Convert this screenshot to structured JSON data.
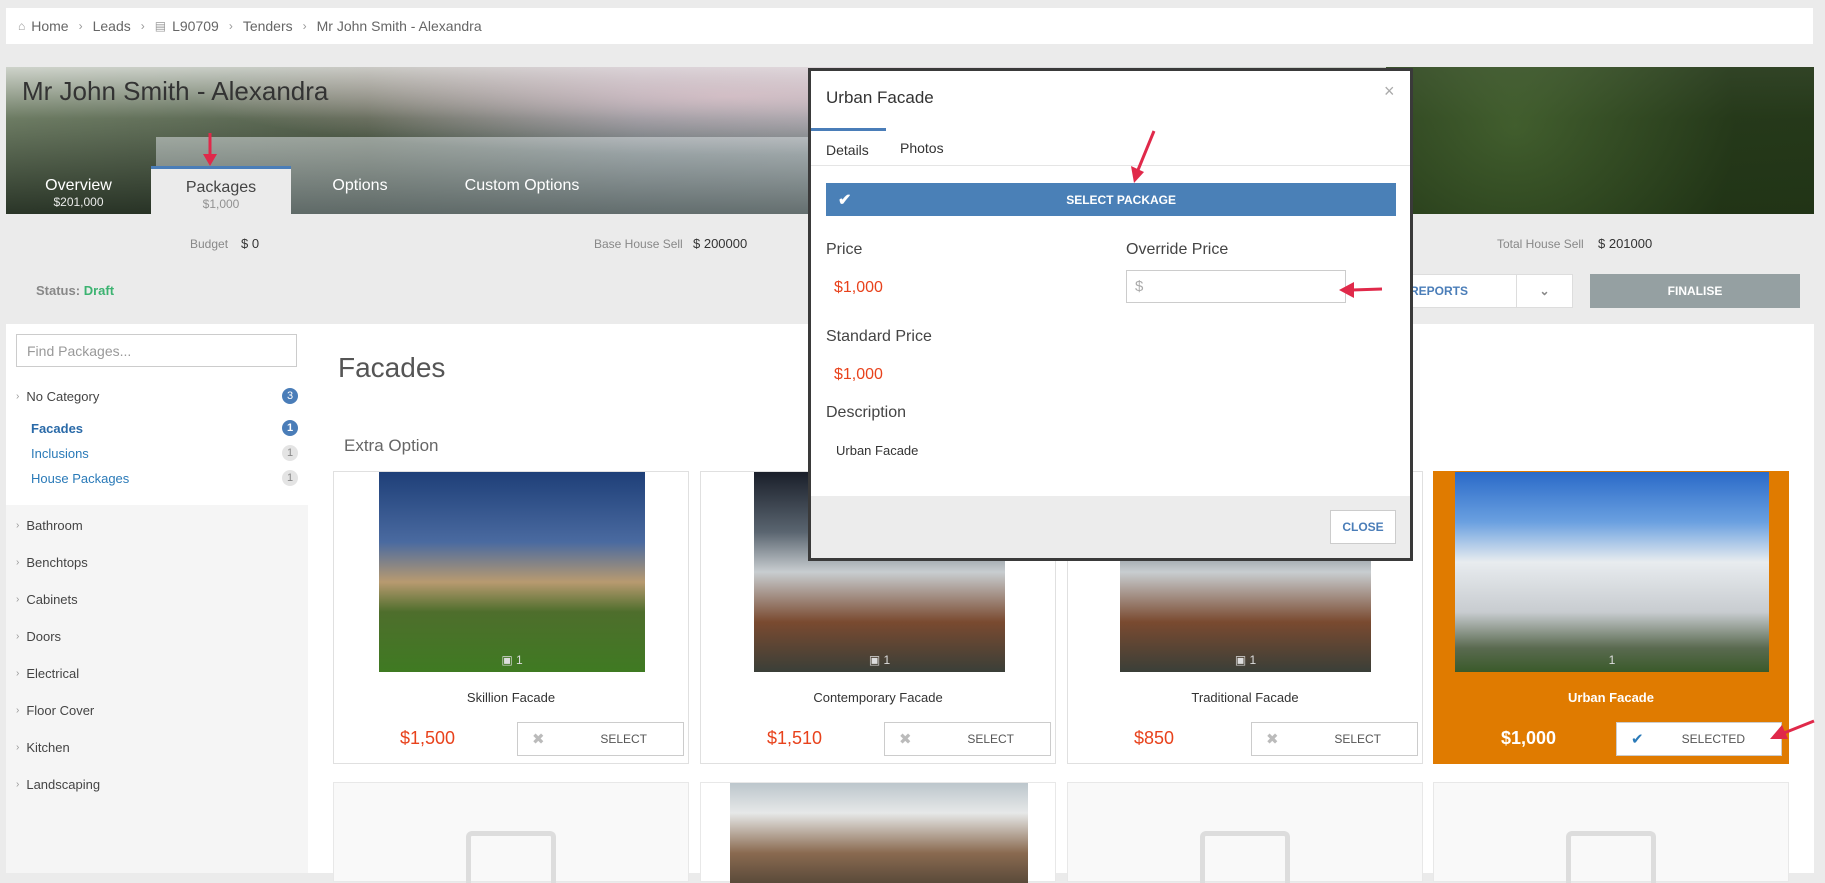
{
  "breadcrumb": [
    "Home",
    "Leads",
    "L90709",
    "Tenders",
    "Mr John Smith - Alexandra"
  ],
  "page": {
    "title": "Mr John Smith - Alexandra",
    "tabs": [
      {
        "label": "Overview",
        "sub": "$201,000"
      },
      {
        "label": "Packages",
        "sub": "$1,000"
      },
      {
        "label": "Options",
        "sub": ""
      },
      {
        "label": "Custom Options",
        "sub": ""
      }
    ]
  },
  "summary": {
    "budget_label": "Budget",
    "budget_value": "$ 0",
    "base_label": "Base House Sell",
    "base_value": "$ 200000",
    "total_label": "Total House Sell",
    "total_value": "$ 201000",
    "status_label": "Status:",
    "status_value": "Draft",
    "reports_label": "REPORTS",
    "finalise_label": "FINALISE"
  },
  "sidebar": {
    "search_placeholder": "Find Packages...",
    "no_category": {
      "label": "No Category",
      "count": "3"
    },
    "subitems": [
      {
        "label": "Facades",
        "count": "1"
      },
      {
        "label": "Inclusions",
        "count": "1"
      },
      {
        "label": "House Packages",
        "count": "1"
      }
    ],
    "categories": [
      "Bathroom",
      "Benchtops",
      "Cabinets",
      "Doors",
      "Electrical",
      "Floor Cover",
      "Kitchen",
      "Landscaping"
    ]
  },
  "main": {
    "heading": "Facades",
    "subheading": "Extra Option",
    "cards": [
      {
        "name": "Skillion Facade",
        "price": "$1,500",
        "button": "SELECT",
        "photos": "1"
      },
      {
        "name": "Contemporary Facade",
        "price": "$1,510",
        "button": "SELECT",
        "photos": "1"
      },
      {
        "name": "Traditional Facade",
        "price": "$850",
        "button": "SELECT",
        "photos": "1"
      },
      {
        "name": "Urban Facade",
        "price": "$1,000",
        "button": "SELECTED",
        "photos": "1"
      }
    ]
  },
  "modal": {
    "title": "Urban Facade",
    "tabs": [
      "Details",
      "Photos"
    ],
    "select_button": "SELECT PACKAGE",
    "price_label": "Price",
    "price_value": "$1,000",
    "override_label": "Override Price",
    "override_placeholder": "$",
    "standard_label": "Standard Price",
    "standard_value": "$1,000",
    "description_label": "Description",
    "description_value": "Urban Facade",
    "close_button": "CLOSE"
  },
  "colors": {
    "accent": "#4a7db8",
    "selected": "#e07b00",
    "price": "#e8421c",
    "arrow": "#e0294a"
  }
}
